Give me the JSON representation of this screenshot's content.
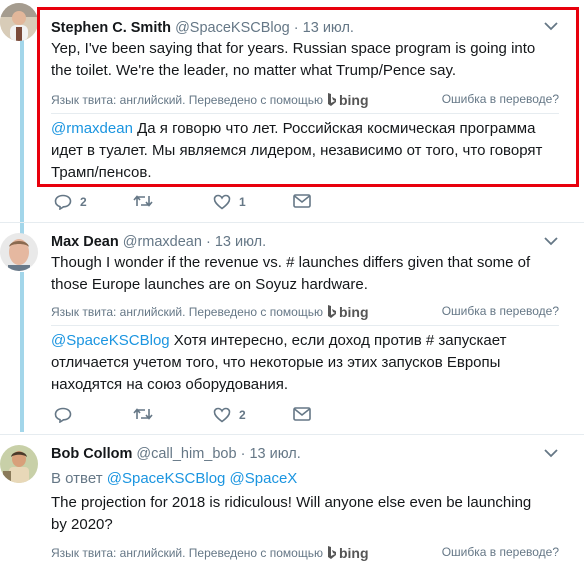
{
  "tweets": [
    {
      "name": "Stephen C. Smith",
      "handle": "@SpaceKSCBlog",
      "sep": "·",
      "time": "13 июл.",
      "text": "Yep, I've been saying that for years. Russian space program is going into the toilet. We're the leader, no matter what Trump/Pence say.",
      "lang_label": "Язык твита: английский. Переведено с помощью",
      "bing": "bing",
      "error_label": "Ошибка в переводе?",
      "translation_mention": "@rmaxdean",
      "translation_text": " Да я говорю что лет. Российская космическая программа идет в туалет. Мы являемся лидером, независимо от того, что говорят Трамп/пенсов.",
      "replies": "2",
      "likes": "1"
    },
    {
      "name": "Max Dean",
      "handle": "@rmaxdean",
      "sep": "·",
      "time": "13 июл.",
      "text": "Though I wonder if the revenue vs. # launches differs given that some of those Europe launches are on Soyuz hardware.",
      "lang_label": "Язык твита: английский. Переведено с помощью",
      "bing": "bing",
      "error_label": "Ошибка в переводе?",
      "translation_mention": "@SpaceKSCBlog",
      "translation_text": " Хотя интересно, если доход против # запускает отличается учетом того, что некоторые из этих запусков Европы находятся на союз оборудования.",
      "likes": "2"
    },
    {
      "name": "Bob Collom",
      "handle": "@call_him_bob",
      "sep": "·",
      "time": "13 июл.",
      "reply_prefix": "В ответ",
      "reply_to_1": "@SpaceKSCBlog",
      "reply_to_2": "@SpaceX",
      "text": "The projection for 2018 is ridiculous! Will anyone else even be launching by 2020?",
      "lang_label": "Язык твита: английский. Переведено с помощью",
      "bing": "bing",
      "error_label": "Ошибка в переводе?"
    }
  ]
}
